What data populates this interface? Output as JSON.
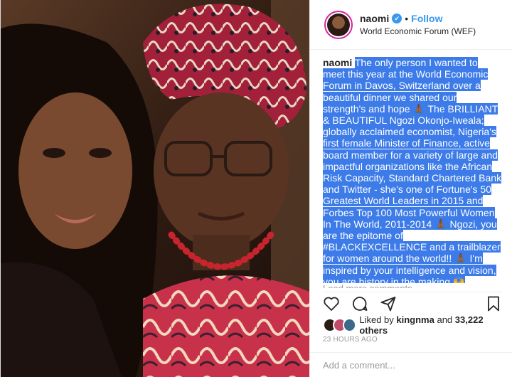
{
  "header": {
    "username": "naomi",
    "follow_label": "Follow",
    "location": "World Economic Forum (WEF)",
    "verified_mark": "✔"
  },
  "caption": {
    "username": "naomi",
    "text": "The only person I wanted to meet this year at the World Economic Forum in Davos, Switzerland over a beautiful dinner we shared our strength's and hope 🙏🏾 The BRILLIANT & BEAUTIFUL Ngozi Okonjo-Iweala; globally acclaimed economist, Nigeria's first female Minister of Finance, active board member for a variety of large and impactful organizations like the African Risk Capacity, Standard Chartered Bank and Twitter - she's one of Fortune's 50 Greatest World Leaders in 2015 and Forbes Top 100 Most Powerful Women In The World, 2011-2014 🙏🏾 Ngozi, you are the epitome of #BLACKEXCELLENCE and a trailblazer for women around the world!! 🙏🏾 I'm inspired by your intelligence and vision, you are history in the making 🙌 #BlackHistoryMonth 🇳🇬♥"
  },
  "load_more": "Load more comments",
  "actions": {
    "like": "heart-icon",
    "comment": "comment-icon",
    "share": "share-icon",
    "save": "bookmark-icon"
  },
  "likes": {
    "prefix": "Liked by ",
    "user": "kingnma",
    "middle": " and ",
    "count": "33,222 others"
  },
  "timestamp": "23 HOURS AGO",
  "comment": {
    "placeholder": "Add a comment..."
  },
  "colors": {
    "link_blue": "#3897f0",
    "highlight": "#3c7be8"
  }
}
